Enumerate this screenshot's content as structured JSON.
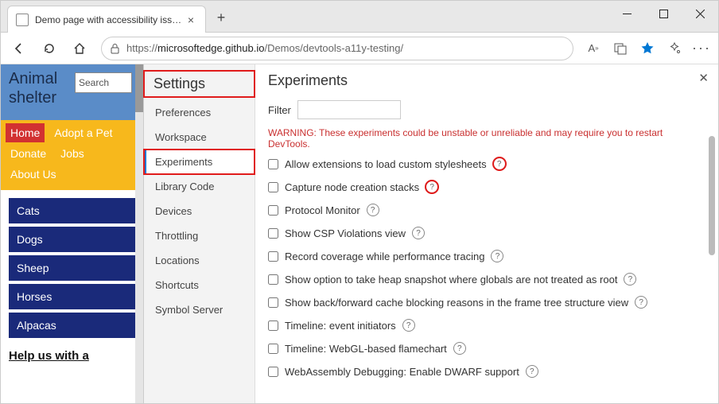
{
  "tab": {
    "title": "Demo page with accessibility issues"
  },
  "url": {
    "scheme": "https://",
    "host": "microsoftedge.github.io",
    "path": "/Demos/devtools-a11y-testing/"
  },
  "site": {
    "title_line1": "Animal",
    "title_line2": "shelter",
    "search_placeholder": "Search",
    "nav": [
      "Home",
      "Adopt a Pet",
      "Donate",
      "Jobs",
      "About Us"
    ],
    "categories": [
      "Cats",
      "Dogs",
      "Sheep",
      "Horses",
      "Alpacas"
    ],
    "help_heading": "Help us with a"
  },
  "devtools": {
    "heading": "Settings",
    "items": [
      "Preferences",
      "Workspace",
      "Experiments",
      "Library Code",
      "Devices",
      "Throttling",
      "Locations",
      "Shortcuts",
      "Symbol Server"
    ],
    "active": "Experiments",
    "main_heading": "Experiments",
    "filter_label": "Filter",
    "warning_label": "WARNING:",
    "warning_text": " These experiments could be unstable or unreliable and may require you to restart DevTools.",
    "experiments": [
      {
        "label": "Allow extensions to load custom stylesheets",
        "help": true,
        "box_help": true
      },
      {
        "label": "Capture node creation stacks",
        "help": true,
        "box_help": true
      },
      {
        "label": "Protocol Monitor",
        "help": true
      },
      {
        "label": "Show CSP Violations view",
        "help": true
      },
      {
        "label": "Record coverage while performance tracing",
        "help": true
      },
      {
        "label": "Show option to take heap snapshot where globals are not treated as root",
        "help": true
      },
      {
        "label": "Show back/forward cache blocking reasons in the frame tree structure view",
        "help": true
      },
      {
        "label": "Timeline: event initiators",
        "help": true
      },
      {
        "label": "Timeline: WebGL-based flamechart",
        "help": true
      },
      {
        "label": "WebAssembly Debugging: Enable DWARF support",
        "help": true
      }
    ]
  }
}
